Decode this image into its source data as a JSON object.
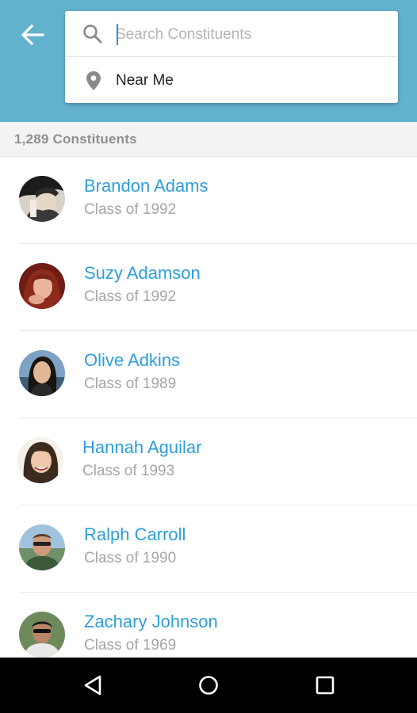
{
  "header": {
    "back_icon": "arrow-left-icon",
    "search": {
      "placeholder": "Search Constituents",
      "value": "",
      "icon": "search-icon"
    },
    "near_me": {
      "label": "Near Me",
      "icon": "location-pin-icon"
    }
  },
  "count_label": "1,289 Constituents",
  "constituents": [
    {
      "name": "Brandon Adams",
      "class_label": "Class of 1992"
    },
    {
      "name": "Suzy Adamson",
      "class_label": "Class of 1992"
    },
    {
      "name": "Olive Adkins",
      "class_label": "Class of 1989"
    },
    {
      "name": "Hannah Aguilar",
      "class_label": "Class of 1993"
    },
    {
      "name": "Ralph Carroll",
      "class_label": "Class of 1990"
    },
    {
      "name": "Zachary Johnson",
      "class_label": "Class of 1969"
    }
  ],
  "nav": {
    "back": "triangle-back-icon",
    "home": "circle-home-icon",
    "recents": "square-recents-icon"
  },
  "colors": {
    "header": "#62b1cd",
    "name": "#2d9fd9",
    "subtitle": "#a6a6a6"
  }
}
